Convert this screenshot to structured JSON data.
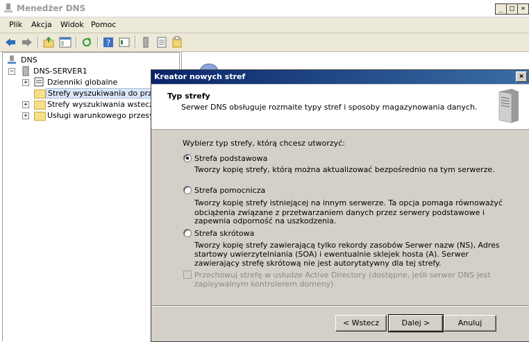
{
  "window": {
    "title": "Menedżer DNS"
  },
  "menu": {
    "items": [
      "Plik",
      "Akcja",
      "Widok",
      "Pomoc"
    ]
  },
  "toolbar": {
    "icons": [
      "back-arrow-icon",
      "forward-arrow-icon",
      "up-folder-icon",
      "show-tree-icon",
      "refresh-icon",
      "help-icon",
      "properties-icon",
      "server-icon",
      "list-icon",
      "export-icon"
    ]
  },
  "tree": {
    "root": "DNS",
    "server": "DNS-SERVER1",
    "items": [
      "Dzienniki globalne",
      "Strefy wyszukiwania do przodu",
      "Strefy wyszukiwania wstecznego",
      "Usługi warunkowego przesyłania dalej"
    ]
  },
  "wizard": {
    "title": "Kreator nowych stref",
    "close": "×",
    "header_title": "Typ strefy",
    "header_subtitle": "Serwer DNS obsługuje rozmaite typy stref i sposoby magazynowania danych.",
    "prompt": "Wybierz typ strefy, którą chcesz utworzyć:",
    "options": [
      {
        "label": "Strefa podstawowa",
        "selected": true,
        "desc": [
          "Tworzy kopię strefy, którą można aktualizować bezpośrednio na tym serwerze."
        ]
      },
      {
        "label": "Strefa pomocnicza",
        "selected": false,
        "desc": [
          "Tworzy kopię strefy istniejącej na innym serwerze. Ta opcja pomaga równoważyć",
          "obciążenia związane z przetwarzaniem danych przez serwery podstawowe i",
          "zapewnia odporność na uszkodzenia."
        ]
      },
      {
        "label": "Strefa skrótowa",
        "selected": false,
        "desc": [
          "Tworzy kopię strefy zawierającą tylko rekordy zasobów Serwer nazw (NS), Adres",
          "startowy uwierzytelniania (SOA) i ewentualnie sklejek hosta (A). Serwer",
          "zawierający strefę skrótową nie jest autorytatywny dla tej strefy."
        ]
      }
    ],
    "ad_checkbox": {
      "lines": [
        "Przechowuj strefę w usłudze Active Directory (dostępne, jeśli serwer DNS jest",
        "zapisywalnym kontrolerem domeny)"
      ],
      "checked": false,
      "enabled": false
    },
    "buttons": {
      "back": "< Wstecz",
      "next": "Dalej >",
      "cancel": "Anuluj"
    }
  }
}
